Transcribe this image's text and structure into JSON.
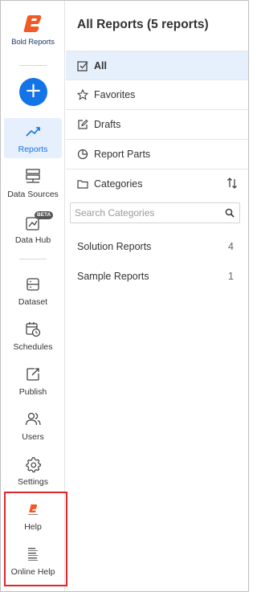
{
  "brand": {
    "name": "Bold Reports"
  },
  "colors": {
    "accent": "#1473e6",
    "active_bg": "#e6effc",
    "brand_orange": "#f15a24",
    "highlight_border": "#e1242b"
  },
  "rail": {
    "create_symbol": "+",
    "items": [
      {
        "label": "Reports",
        "icon": "trending-up-icon"
      },
      {
        "label": "Data Sources",
        "icon": "server-icon"
      },
      {
        "label": "Data Hub",
        "icon": "data-hub-icon",
        "badge": "BETA"
      },
      {
        "label": "Dataset",
        "icon": "dataset-icon"
      },
      {
        "label": "Schedules",
        "icon": "calendar-clock-icon"
      },
      {
        "label": "Publish",
        "icon": "publish-icon"
      },
      {
        "label": "Users",
        "icon": "users-icon"
      },
      {
        "label": "Settings",
        "icon": "gear-icon"
      },
      {
        "label": "Help",
        "icon": "help-logo-icon"
      },
      {
        "label": "Online Help",
        "icon": "online-help-icon"
      }
    ]
  },
  "panel": {
    "title": "All Reports (5 reports)",
    "filters": [
      {
        "label": "All",
        "icon": "checkbox-icon"
      },
      {
        "label": "Favorites",
        "icon": "star-icon"
      },
      {
        "label": "Drafts",
        "icon": "edit-icon"
      },
      {
        "label": "Report Parts",
        "icon": "pie-chart-icon"
      }
    ],
    "categories_label": "Categories",
    "search_placeholder": "Search Categories",
    "categories": [
      {
        "name": "Solution Reports",
        "count": "4"
      },
      {
        "name": "Sample Reports",
        "count": "1"
      }
    ]
  }
}
